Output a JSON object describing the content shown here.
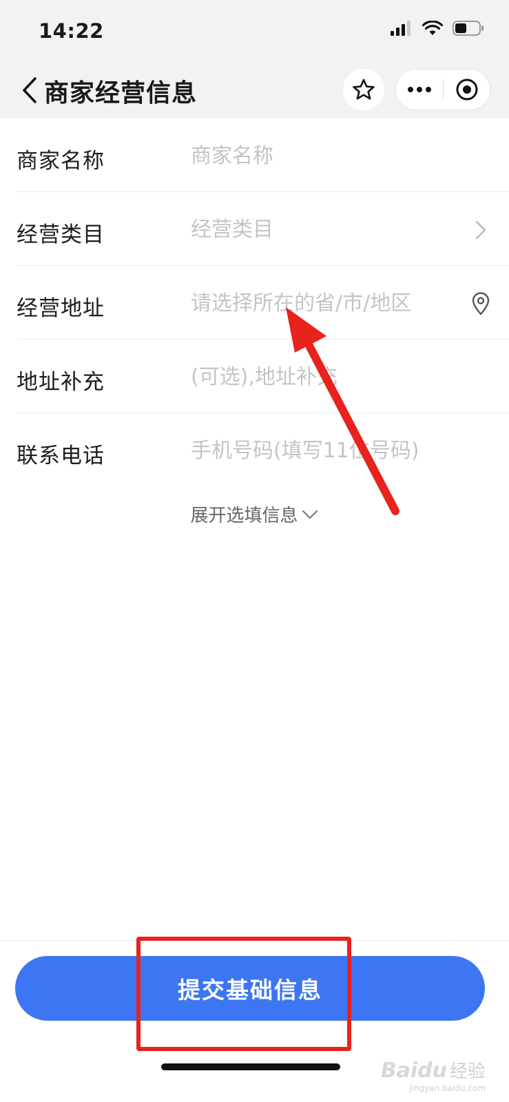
{
  "status_bar": {
    "time": "14:22",
    "icons": [
      "signal-icon",
      "wifi-icon",
      "battery-icon"
    ]
  },
  "nav": {
    "title": "商家经营信息",
    "back_icon": "chevron-left-icon",
    "favorite_icon": "star-icon",
    "more_icon": "more-dots-icon",
    "close_icon": "target-close-icon"
  },
  "form": {
    "rows": [
      {
        "label": "商家名称",
        "placeholder": "商家名称",
        "value": ""
      },
      {
        "label": "经营类目",
        "placeholder": "经营类目",
        "value": "",
        "right_icon": "chevron-right-icon"
      },
      {
        "label": "经营地址",
        "placeholder": "请选择所在的省/市/地区",
        "value": "",
        "right_icon": "location-pin-icon"
      },
      {
        "label": "地址补充",
        "placeholder": "(可选),地址补充",
        "value": ""
      },
      {
        "label": "联系电话",
        "placeholder": "手机号码(填写11位号码)",
        "value": ""
      }
    ]
  },
  "expand_label": "展开选填信息",
  "submit_label": "提交基础信息",
  "watermark": {
    "brand": "Baidu",
    "suffix": "经验",
    "url": "jingyan.baidu.com"
  },
  "colors": {
    "accent": "#3d76f2",
    "annotation": "#e8221c",
    "header_bg": "#f2f2f2"
  }
}
